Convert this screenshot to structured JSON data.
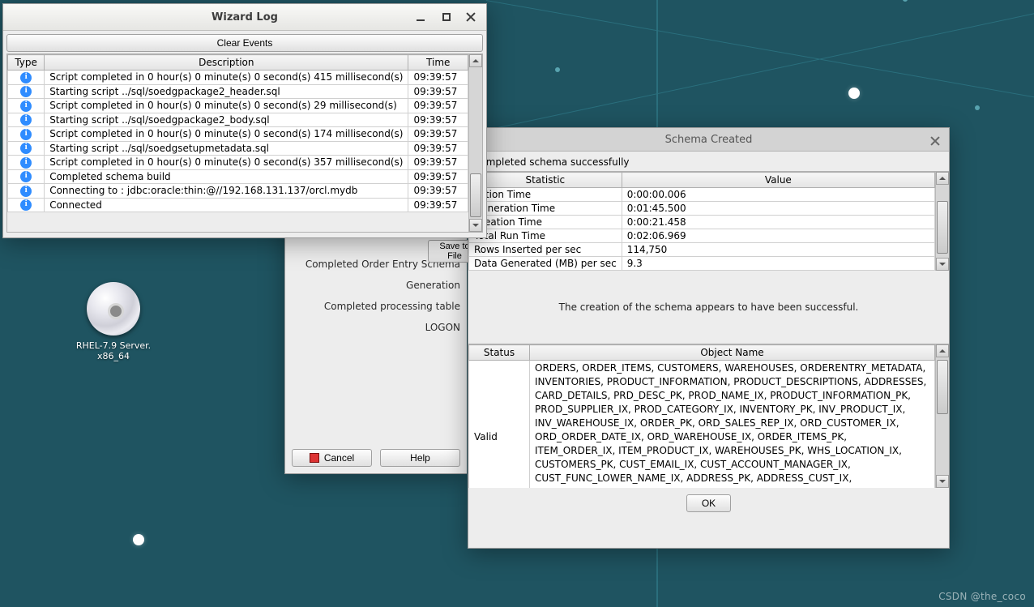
{
  "desktop": {
    "icon_label_l1": "RHEL-7.9 Server.",
    "icon_label_l2": "x86_64"
  },
  "wizardlog": {
    "title": "Wizard Log",
    "clear_button": "Clear Events",
    "columns": {
      "type": "Type",
      "description": "Description",
      "time": "Time"
    },
    "rows": [
      {
        "desc": "Script completed in 0 hour(s) 0 minute(s) 0 second(s) 415 millisecond(s)",
        "time": "09:39:57"
      },
      {
        "desc": "Starting script ../sql/soedgpackage2_header.sql",
        "time": "09:39:57"
      },
      {
        "desc": "Script completed in 0 hour(s) 0 minute(s) 0 second(s) 29 millisecond(s)",
        "time": "09:39:57"
      },
      {
        "desc": "Starting script ../sql/soedgpackage2_body.sql",
        "time": "09:39:57"
      },
      {
        "desc": "Script completed in 0 hour(s) 0 minute(s) 0 second(s) 174 millisecond(s)",
        "time": "09:39:57"
      },
      {
        "desc": "Starting script ../sql/soedgsetupmetadata.sql",
        "time": "09:39:57"
      },
      {
        "desc": "Script completed in 0 hour(s) 0 minute(s) 0 second(s) 357 millisecond(s)",
        "time": "09:39:57"
      },
      {
        "desc": "Completed schema build",
        "time": "09:39:57"
      },
      {
        "desc": "Connecting to : jdbc:oracle:thin:@//192.168.131.137/orcl.mydb",
        "time": "09:39:57"
      },
      {
        "desc": "Connected",
        "time": "09:39:57"
      }
    ]
  },
  "save_buttons": {
    "a": "Save to Fil",
    "b": "Save to File"
  },
  "orderentry": {
    "line1": "Completed Order Entry Schema Generation",
    "line2": "Completed processing table LOGON",
    "cancel": "Cancel",
    "help": "Help"
  },
  "schema": {
    "title": "Schema Created",
    "success_msg": "Completed schema successfully",
    "col_stat": "Statistic",
    "col_val": "Value",
    "stats": [
      {
        "k": "ection Time",
        "v": "0:00:00.006"
      },
      {
        "k": "Generation Time",
        "v": "0:01:45.500"
      },
      {
        "k": "Creation Time",
        "v": "0:00:21.458"
      },
      {
        "k": "Total Run Time",
        "v": "0:02:06.969"
      },
      {
        "k": "Rows Inserted per sec",
        "v": "114,750"
      },
      {
        "k": "Data Generated (MB) per sec",
        "v": "9.3"
      }
    ],
    "mid_msg": "The creation of the schema appears to have been successful.",
    "col_status": "Status",
    "col_obj": "Object Name",
    "status_value": "Valid",
    "object_names": "ORDERS, ORDER_ITEMS, CUSTOMERS, WAREHOUSES, ORDERENTRY_METADATA, INVENTORIES, PRODUCT_INFORMATION, PRODUCT_DESCRIPTIONS, ADDRESSES, CARD_DETAILS, PRD_DESC_PK, PROD_NAME_IX, PRODUCT_INFORMATION_PK, PROD_SUPPLIER_IX, PROD_CATEGORY_IX, INVENTORY_PK, INV_PRODUCT_IX, INV_WAREHOUSE_IX, ORDER_PK, ORD_SALES_REP_IX, ORD_CUSTOMER_IX, ORD_ORDER_DATE_IX, ORD_WAREHOUSE_IX, ORDER_ITEMS_PK, ITEM_ORDER_IX, ITEM_PRODUCT_IX, WAREHOUSES_PK, WHS_LOCATION_IX, CUSTOMERS_PK, CUST_EMAIL_IX, CUST_ACCOUNT_MANAGER_IX, CUST_FUNC_LOWER_NAME_IX, ADDRESS_PK, ADDRESS_CUST_IX, CARD_DETAILS_PK, CARDDETAILS_CUST_IX, PRODUCTS, PRODUCT_PRICES, CUSTOMER_SEQ, ORDERS_SEQ, ADDRESS_SEQ, LOGON_SEQ,",
    "ok": "OK"
  },
  "watermark": "CSDN @the_coco"
}
